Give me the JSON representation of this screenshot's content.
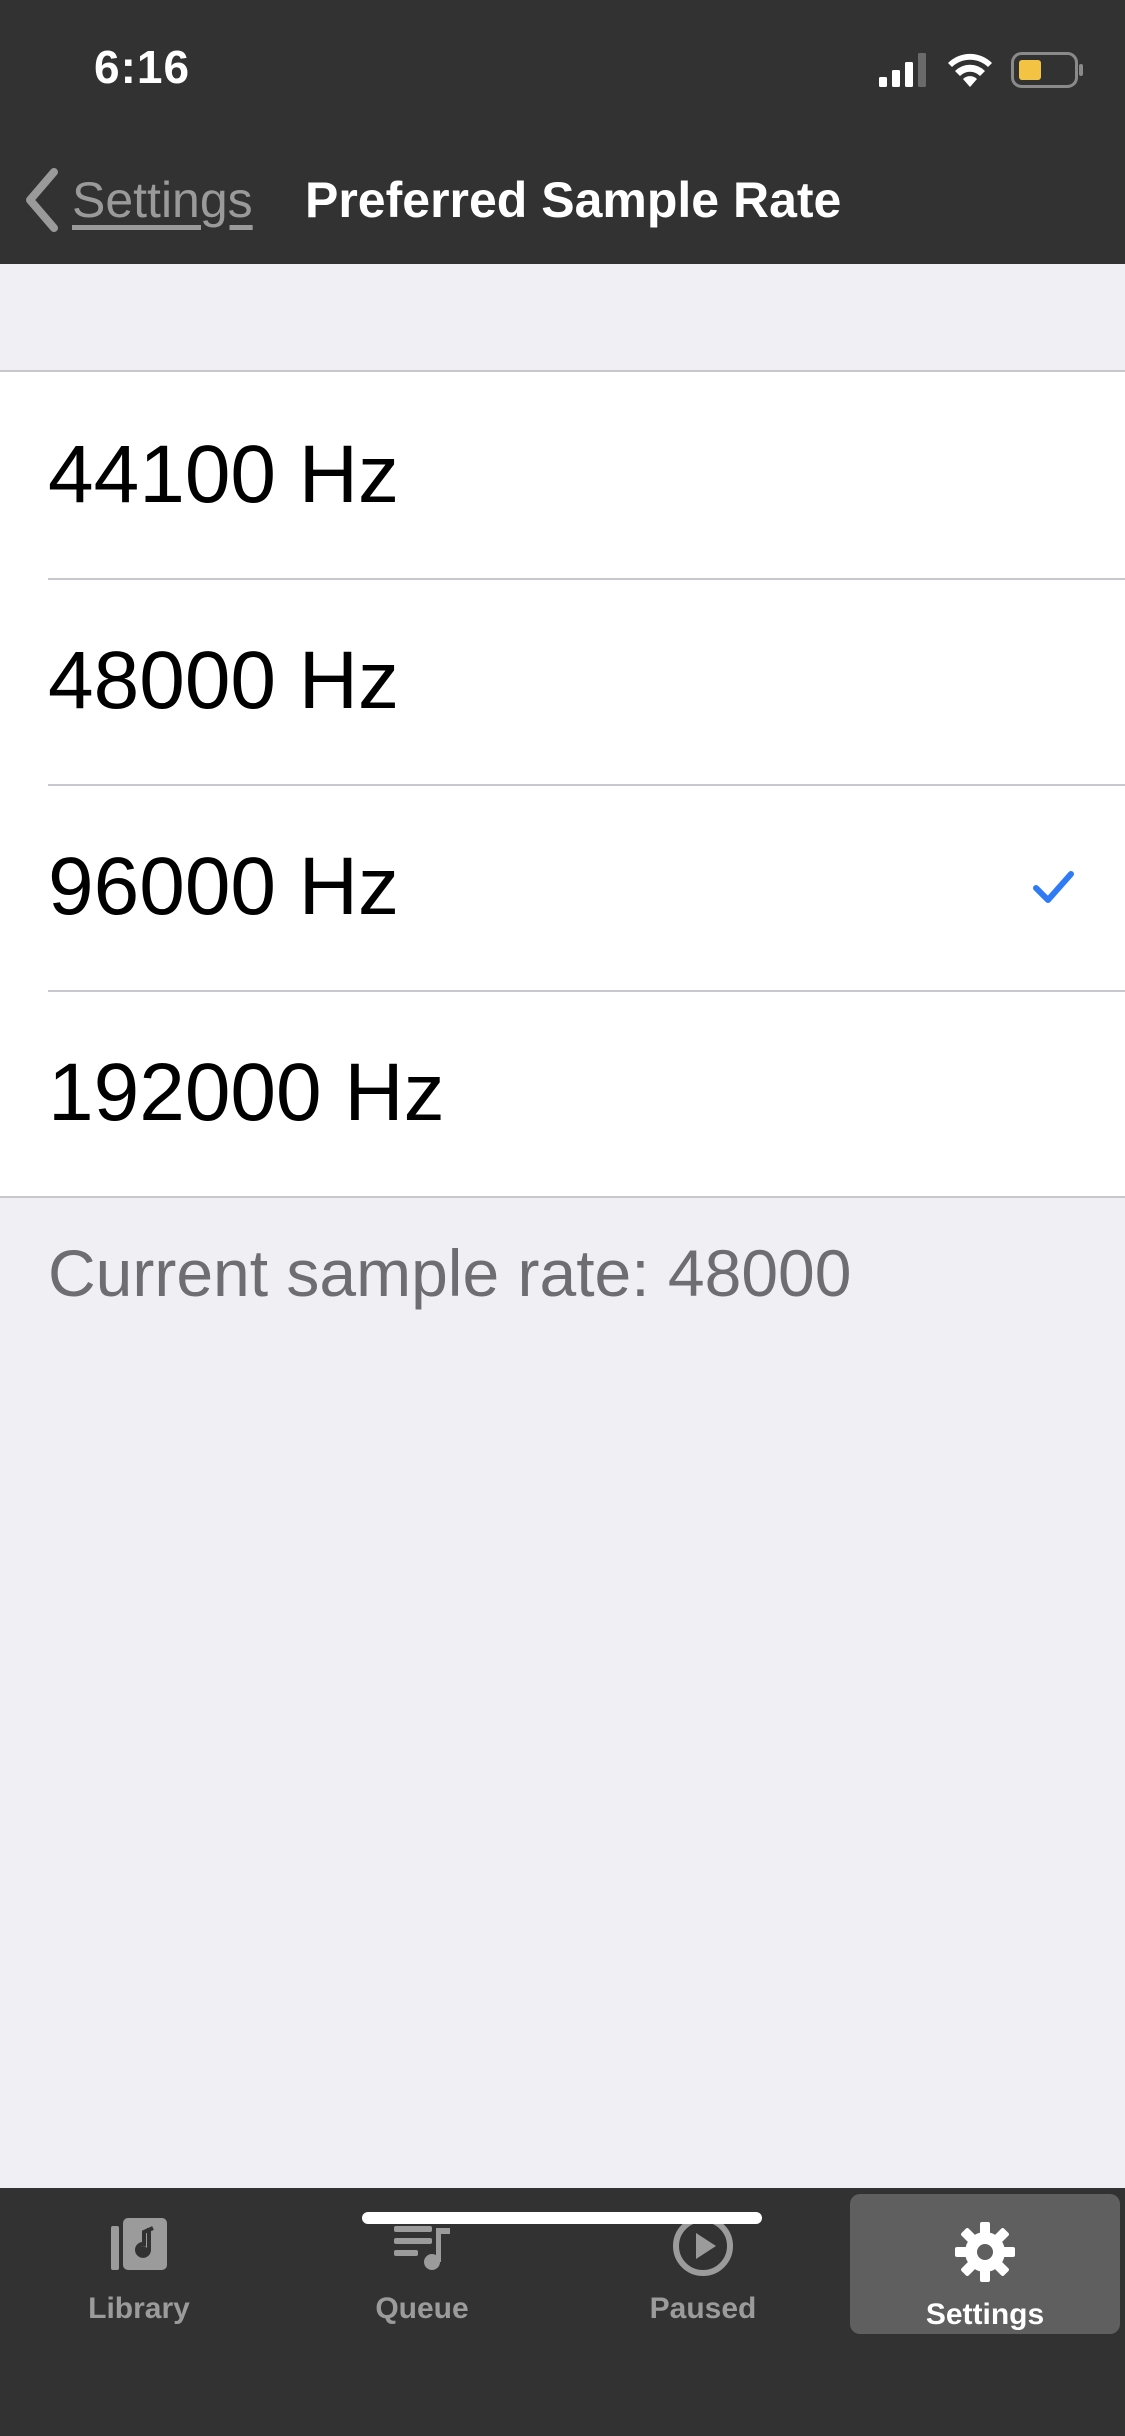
{
  "status_bar": {
    "time": "6:16"
  },
  "nav": {
    "back_label": "Settings",
    "title": "Preferred Sample Rate"
  },
  "options": [
    {
      "label": "44100 Hz",
      "selected": false
    },
    {
      "label": "48000 Hz",
      "selected": false
    },
    {
      "label": "96000 Hz",
      "selected": true
    },
    {
      "label": "192000 Hz",
      "selected": false
    }
  ],
  "footer_note": "Current sample rate: 48000",
  "tabs": [
    {
      "label": "Library",
      "icon": "library-icon"
    },
    {
      "label": "Queue",
      "icon": "queue-icon"
    },
    {
      "label": "Paused",
      "icon": "play-circle-icon"
    },
    {
      "label": "Settings",
      "icon": "gear-icon",
      "active": true
    }
  ],
  "colors": {
    "bar_bg": "#323232",
    "accent": "#2f7bf5",
    "battery": "#f3c443"
  }
}
